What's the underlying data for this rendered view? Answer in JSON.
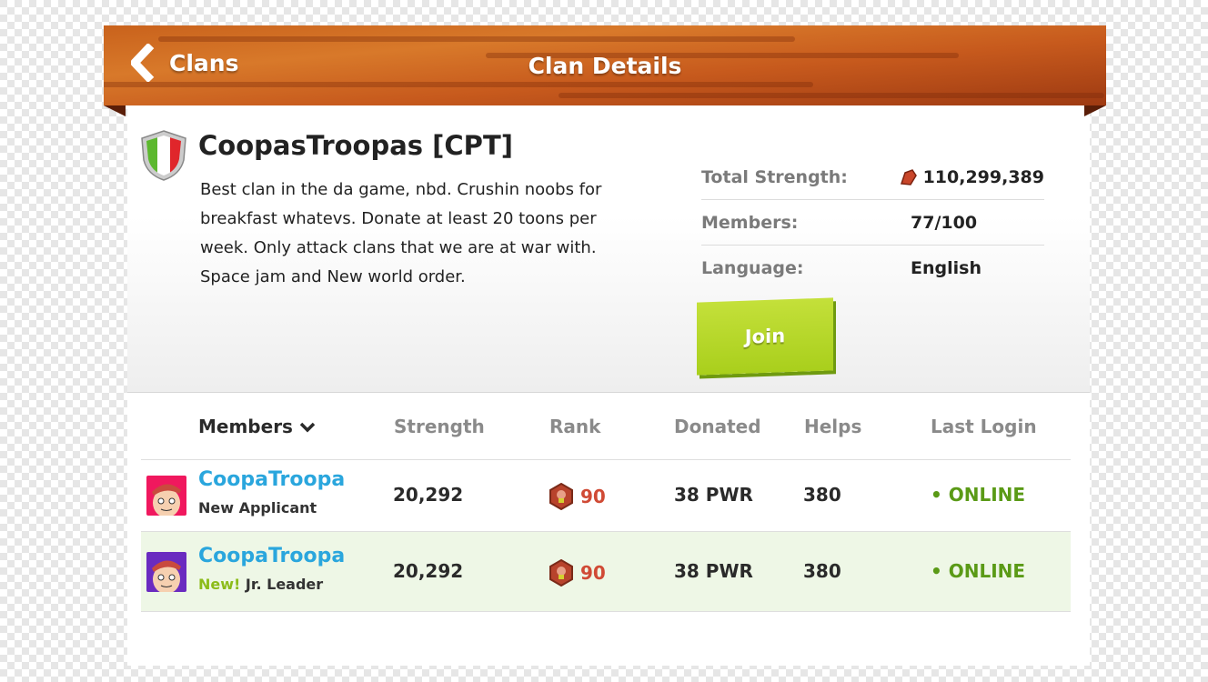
{
  "header": {
    "back_label": "Clans",
    "title": "Clan Details"
  },
  "clan": {
    "name": "CoopasTroopas [CPT]",
    "flag": "italy-shield-icon",
    "description": "Best clan in the da game, nbd. Crushin noobs for breakfast whatevs. Donate at least 20 toons per week. Only attack clans that we are at war with. Space jam and New world order.",
    "stats": [
      {
        "label": "Total Strength:",
        "value": "110,299,389",
        "icon": "strength-fist-icon"
      },
      {
        "label": "Members:",
        "value": "77/100"
      },
      {
        "label": "Language:",
        "value": "English"
      }
    ],
    "join_label": "Join"
  },
  "table": {
    "columns": [
      "Members",
      "Strength",
      "Rank",
      "Donated",
      "Helps",
      "Last Login"
    ],
    "rows": [
      {
        "name": "CoopaTroopa",
        "tag": "",
        "role": "New Applicant",
        "strength": "20,292",
        "rank": "90",
        "donated": "38 PWR",
        "helps": "380",
        "last_login": "ONLINE",
        "avatar_bg": "#f0185e",
        "highlight": false
      },
      {
        "name": "CoopaTroopa",
        "tag": "New!",
        "role": "Jr. Leader",
        "strength": "20,292",
        "rank": "90",
        "donated": "38 PWR",
        "helps": "380",
        "last_login": "ONLINE",
        "avatar_bg": "#6a2bc0",
        "highlight": true
      }
    ]
  },
  "colors": {
    "accent_blue": "#2aa6dd",
    "online_green": "#5a9a16",
    "rank_red": "#d04a35",
    "join_green": "#b4d628",
    "highlight_row": "#eef7e6"
  }
}
